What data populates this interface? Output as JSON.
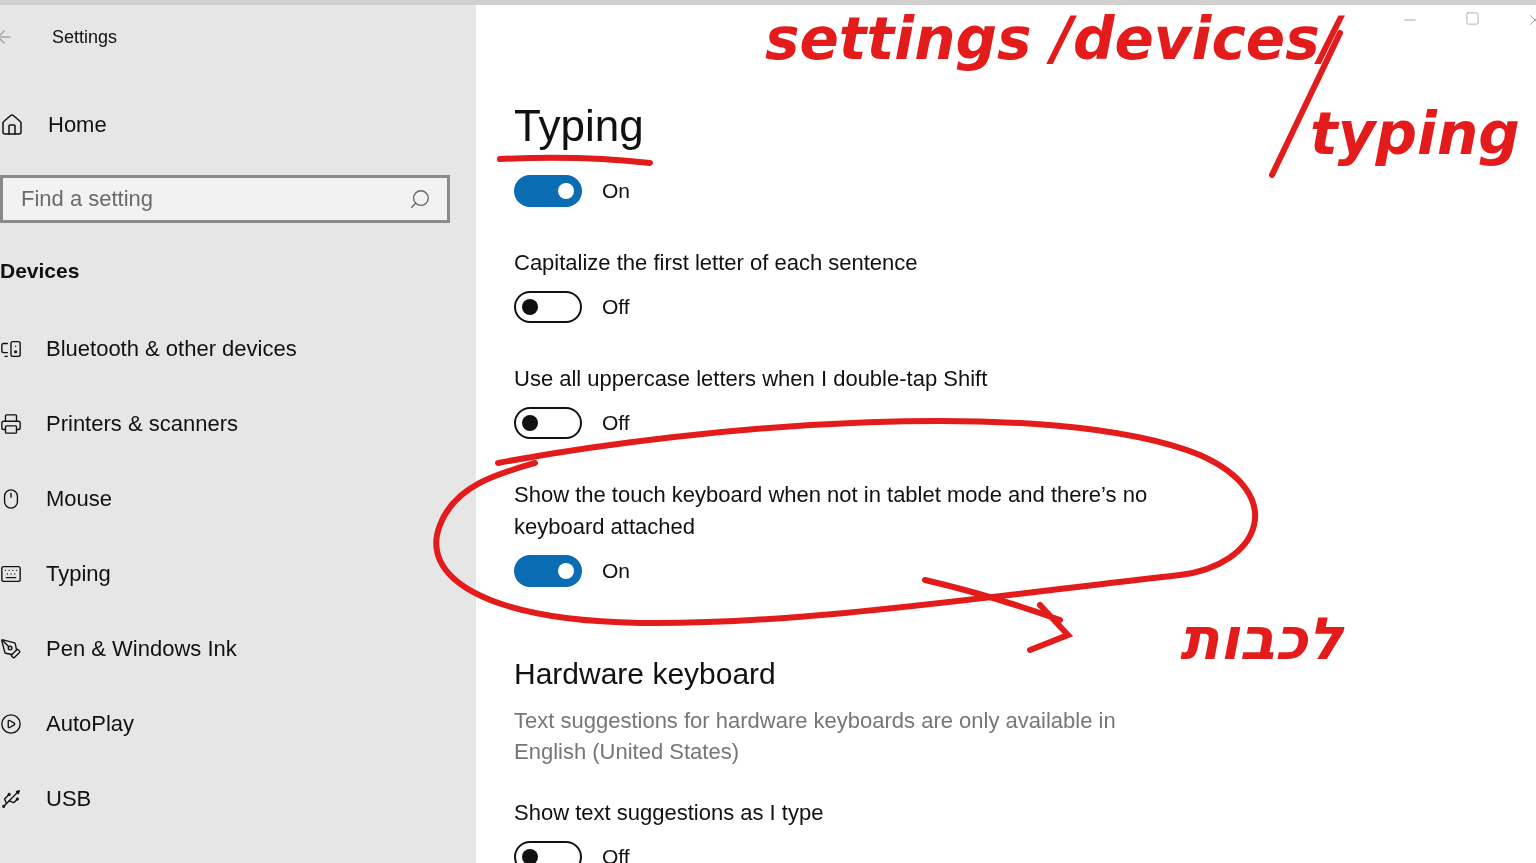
{
  "window": {
    "title": "Settings"
  },
  "sidebar": {
    "home": "Home",
    "search": {
      "placeholder": "Find a setting"
    },
    "section": "Devices",
    "items": [
      {
        "label": "Bluetooth & other devices"
      },
      {
        "label": "Printers & scanners"
      },
      {
        "label": "Mouse"
      },
      {
        "label": "Typing"
      },
      {
        "label": "Pen & Windows Ink"
      },
      {
        "label": "AutoPlay"
      },
      {
        "label": "USB"
      }
    ]
  },
  "main": {
    "title": "Typing",
    "settings": [
      {
        "on": true,
        "state_text": "On"
      },
      {
        "label": "Capitalize the first letter of each sentence",
        "on": false,
        "state_text": "Off"
      },
      {
        "label": "Use all uppercase letters when I double-tap Shift",
        "on": false,
        "state_text": "Off"
      },
      {
        "label": "Show the touch keyboard when not in tablet mode and there’s no keyboard attached",
        "on": true,
        "state_text": "On"
      }
    ],
    "hardware": {
      "heading": "Hardware keyboard",
      "note": "Text suggestions for hardware keyboards are only available in English (United States)",
      "settings": [
        {
          "label": "Show text suggestions as I type",
          "on": false,
          "state_text": "Off"
        }
      ]
    }
  },
  "annotations": [
    {
      "kind": "handwriting",
      "text": "settings /devices/"
    },
    {
      "kind": "handwriting",
      "text": "typing"
    },
    {
      "kind": "handwriting",
      "text": "לכבות"
    }
  ]
}
